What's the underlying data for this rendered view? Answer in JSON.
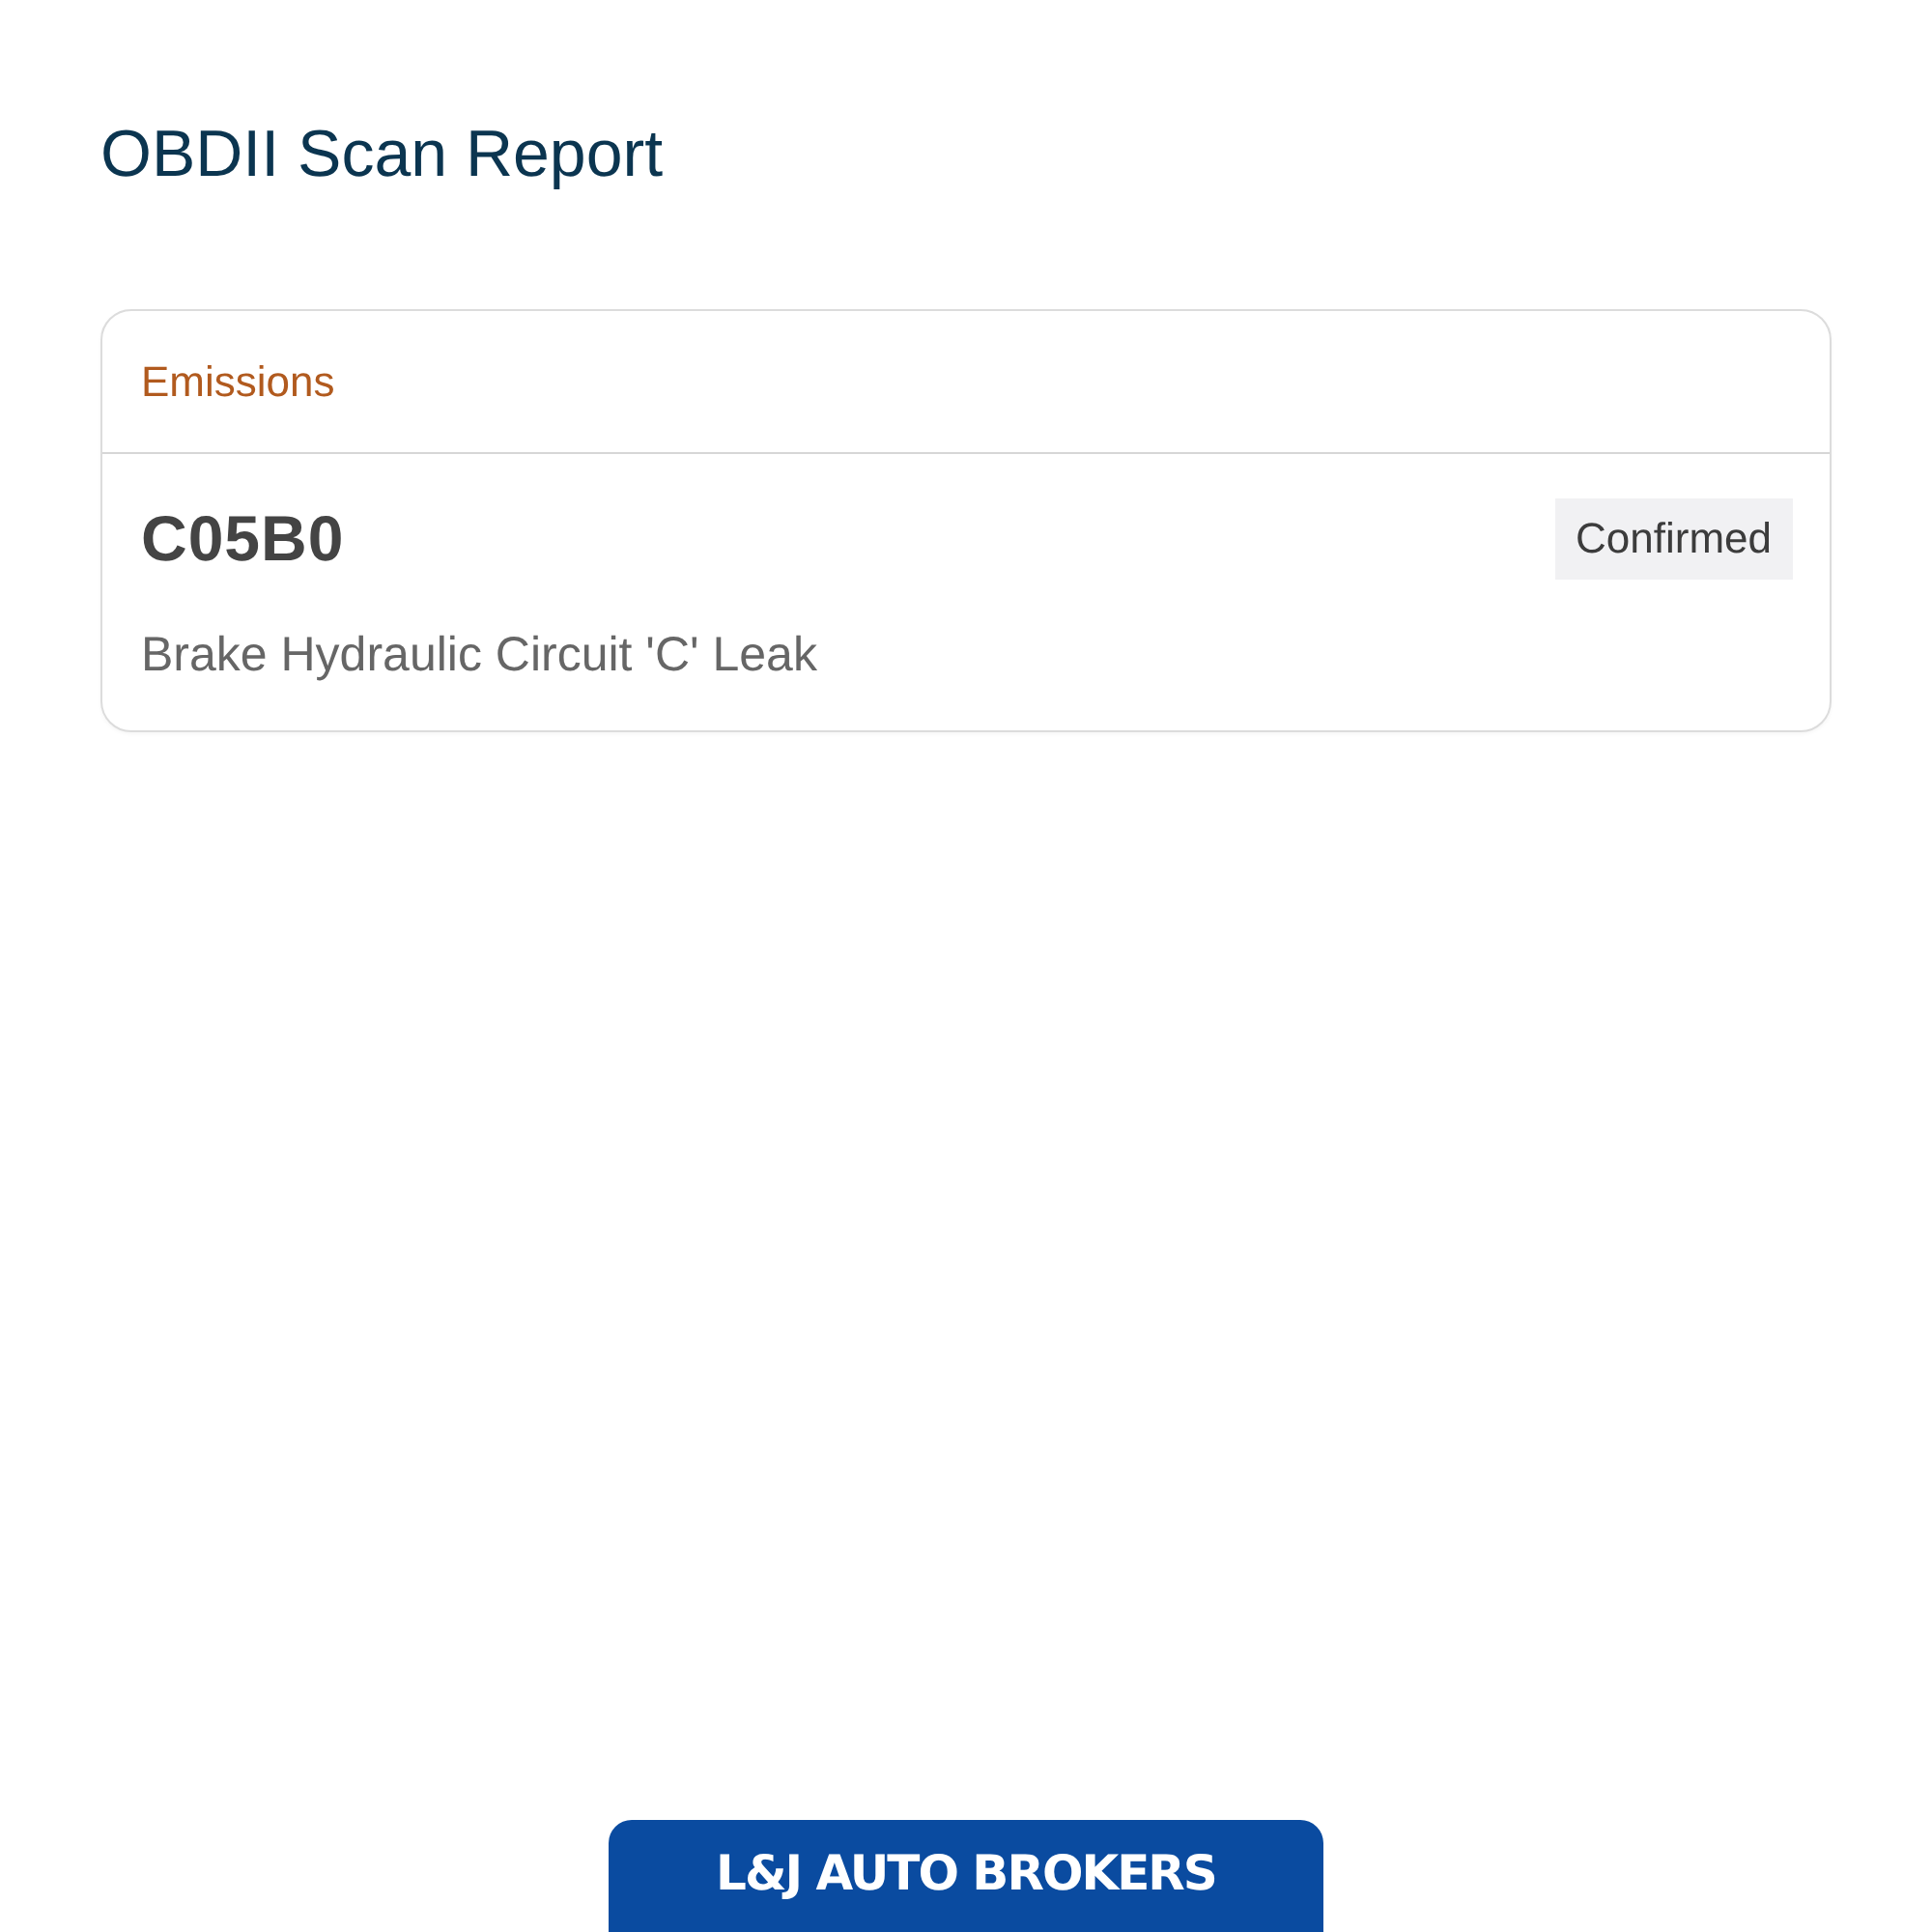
{
  "page": {
    "title": "OBDII Scan Report"
  },
  "sections": [
    {
      "title": "Emissions",
      "codes": [
        {
          "code": "C05B0",
          "status": "Confirmed",
          "description": "Brake Hydraulic Circuit 'C' Leak"
        }
      ]
    }
  ],
  "footer": {
    "logo_text": "L&J AUTO BROKERS"
  }
}
